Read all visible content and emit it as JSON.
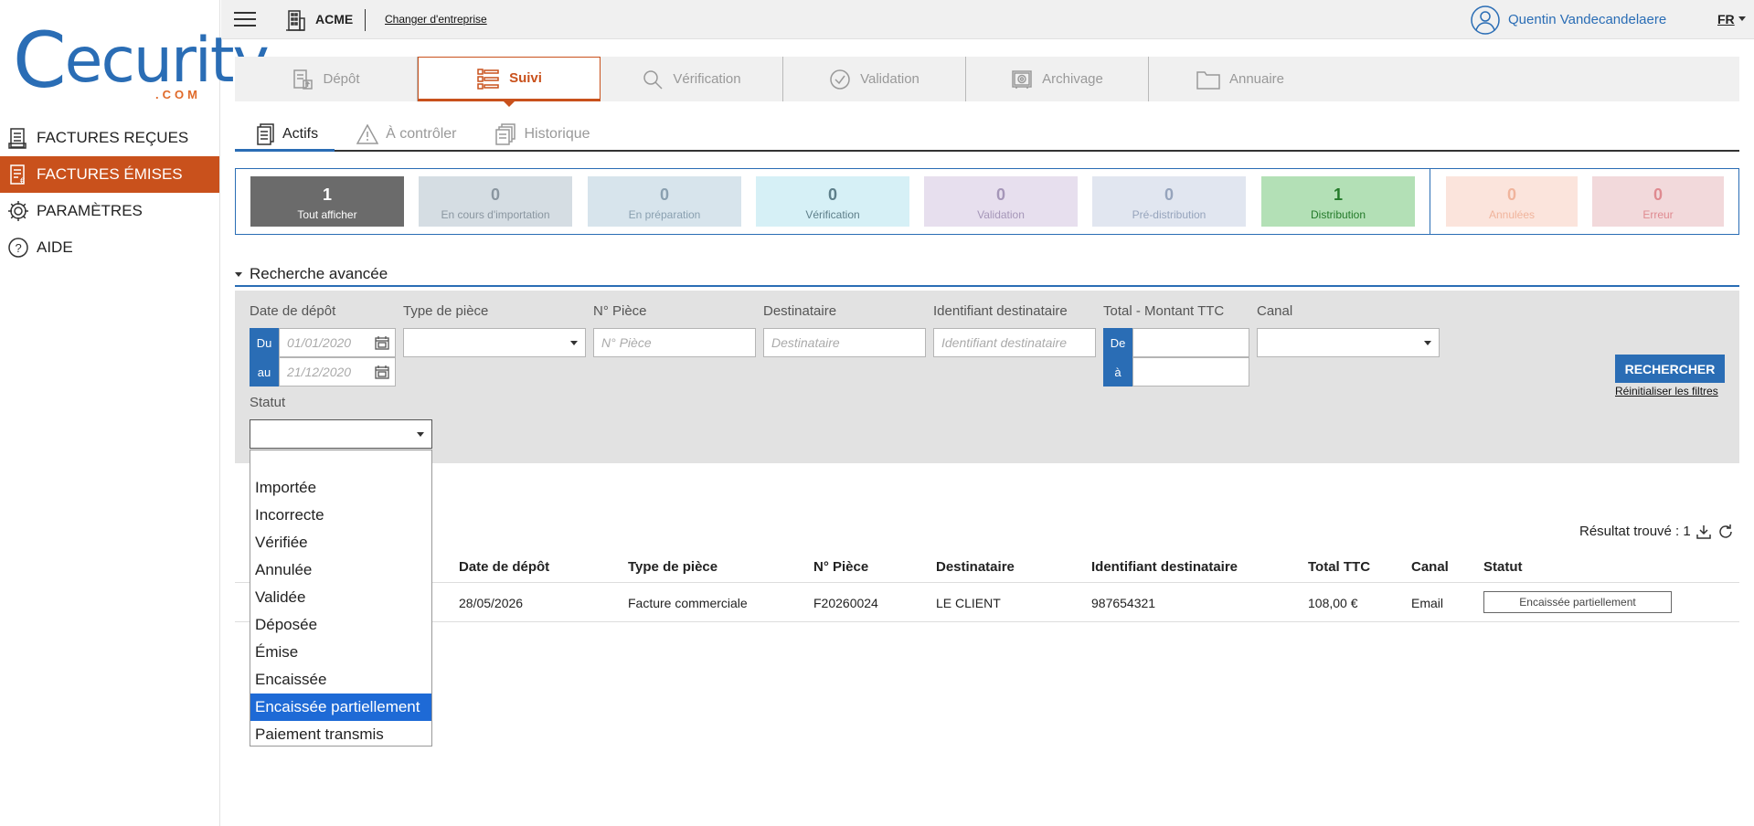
{
  "logo": {
    "brand": "ecurity",
    "c": "C",
    "domain": ".COM"
  },
  "sidebar": {
    "items": [
      {
        "label": "FACTURES REÇUES"
      },
      {
        "label": "FACTURES ÉMISES"
      },
      {
        "label": "PARAMÈTRES"
      },
      {
        "label": "AIDE"
      }
    ]
  },
  "topbar": {
    "company": "ACME",
    "change_company": "Changer d'entreprise",
    "user": "Quentin Vandecandelaere",
    "lang": "FR"
  },
  "main_tabs": [
    {
      "label": "Dépôt"
    },
    {
      "label": "Suivi"
    },
    {
      "label": "Vérification"
    },
    {
      "label": "Validation"
    },
    {
      "label": "Archivage"
    },
    {
      "label": "Annuaire"
    }
  ],
  "sub_tabs": [
    {
      "label": "Actifs"
    },
    {
      "label": "À contrôler"
    },
    {
      "label": "Historique"
    }
  ],
  "status_filters": [
    {
      "count": "1",
      "label": "Tout afficher",
      "bg": "#6b6b6b",
      "fg": "#ffffff"
    },
    {
      "count": "0",
      "label": "En cours d'importation",
      "bg": "#d5dde3",
      "fg": "#8a96a0"
    },
    {
      "count": "0",
      "label": "En préparation",
      "bg": "#d7e4ec",
      "fg": "#8aa0b0"
    },
    {
      "count": "0",
      "label": "Vérification",
      "bg": "#d6f0f6",
      "fg": "#5e7f8a"
    },
    {
      "count": "0",
      "label": "Validation",
      "bg": "#e7dfee",
      "fg": "#a596b8"
    },
    {
      "count": "0",
      "label": "Pré-distribution",
      "bg": "#e1e6f0",
      "fg": "#96a4bc"
    },
    {
      "count": "1",
      "label": "Distribution",
      "bg": "#b3e0b6",
      "fg": "#247a2a"
    },
    {
      "count": "0",
      "label": "Annulées",
      "bg": "#fbe4dc",
      "fg": "#f0b49c"
    },
    {
      "count": "0",
      "label": "Erreur",
      "bg": "#f2d9db",
      "fg": "#df8a90"
    }
  ],
  "search": {
    "title": "Recherche avancée",
    "date_label": "Date de dépôt",
    "du": "Du",
    "au": "au",
    "date_from_placeholder": "01/01/2020",
    "date_to_placeholder": "21/12/2020",
    "type_label": "Type de pièce",
    "piece_label": "N° Pièce",
    "piece_placeholder": "N° Pièce",
    "dest_label": "Destinataire",
    "dest_placeholder": "Destinataire",
    "dest_id_label": "Identifiant destinataire",
    "dest_id_placeholder": "Identifiant destinataire",
    "total_label": "Total - Montant TTC",
    "de": "De",
    "a": "à",
    "canal_label": "Canal",
    "statut_label": "Statut",
    "search_button": "RECHERCHER",
    "reset_link": "Réinitialiser les filtres"
  },
  "statut_options": [
    "Importée",
    "Incorrecte",
    "Vérifiée",
    "Annulée",
    "Validée",
    "Déposée",
    "Émise",
    "Encaissée",
    "Encaissée partiellement",
    "Paiement transmis"
  ],
  "statut_selected_index": 8,
  "results": {
    "count_text": "Résultat trouvé : 1",
    "columns": [
      "Date de dépôt",
      "Type de pièce",
      "N° Pièce",
      "Destinataire",
      "Identifiant destinataire",
      "Total TTC",
      "Canal",
      "Statut"
    ],
    "rows": [
      [
        "28/05/2026",
        "Facture commerciale",
        "F20260024",
        "LE CLIENT",
        "987654321",
        "108,00 €",
        "Email",
        "Encaissée partiellement"
      ]
    ]
  },
  "colors": {
    "accent_orange": "#c9511c",
    "accent_blue": "#2a6db5",
    "selected_blue": "#1e6ad6"
  }
}
